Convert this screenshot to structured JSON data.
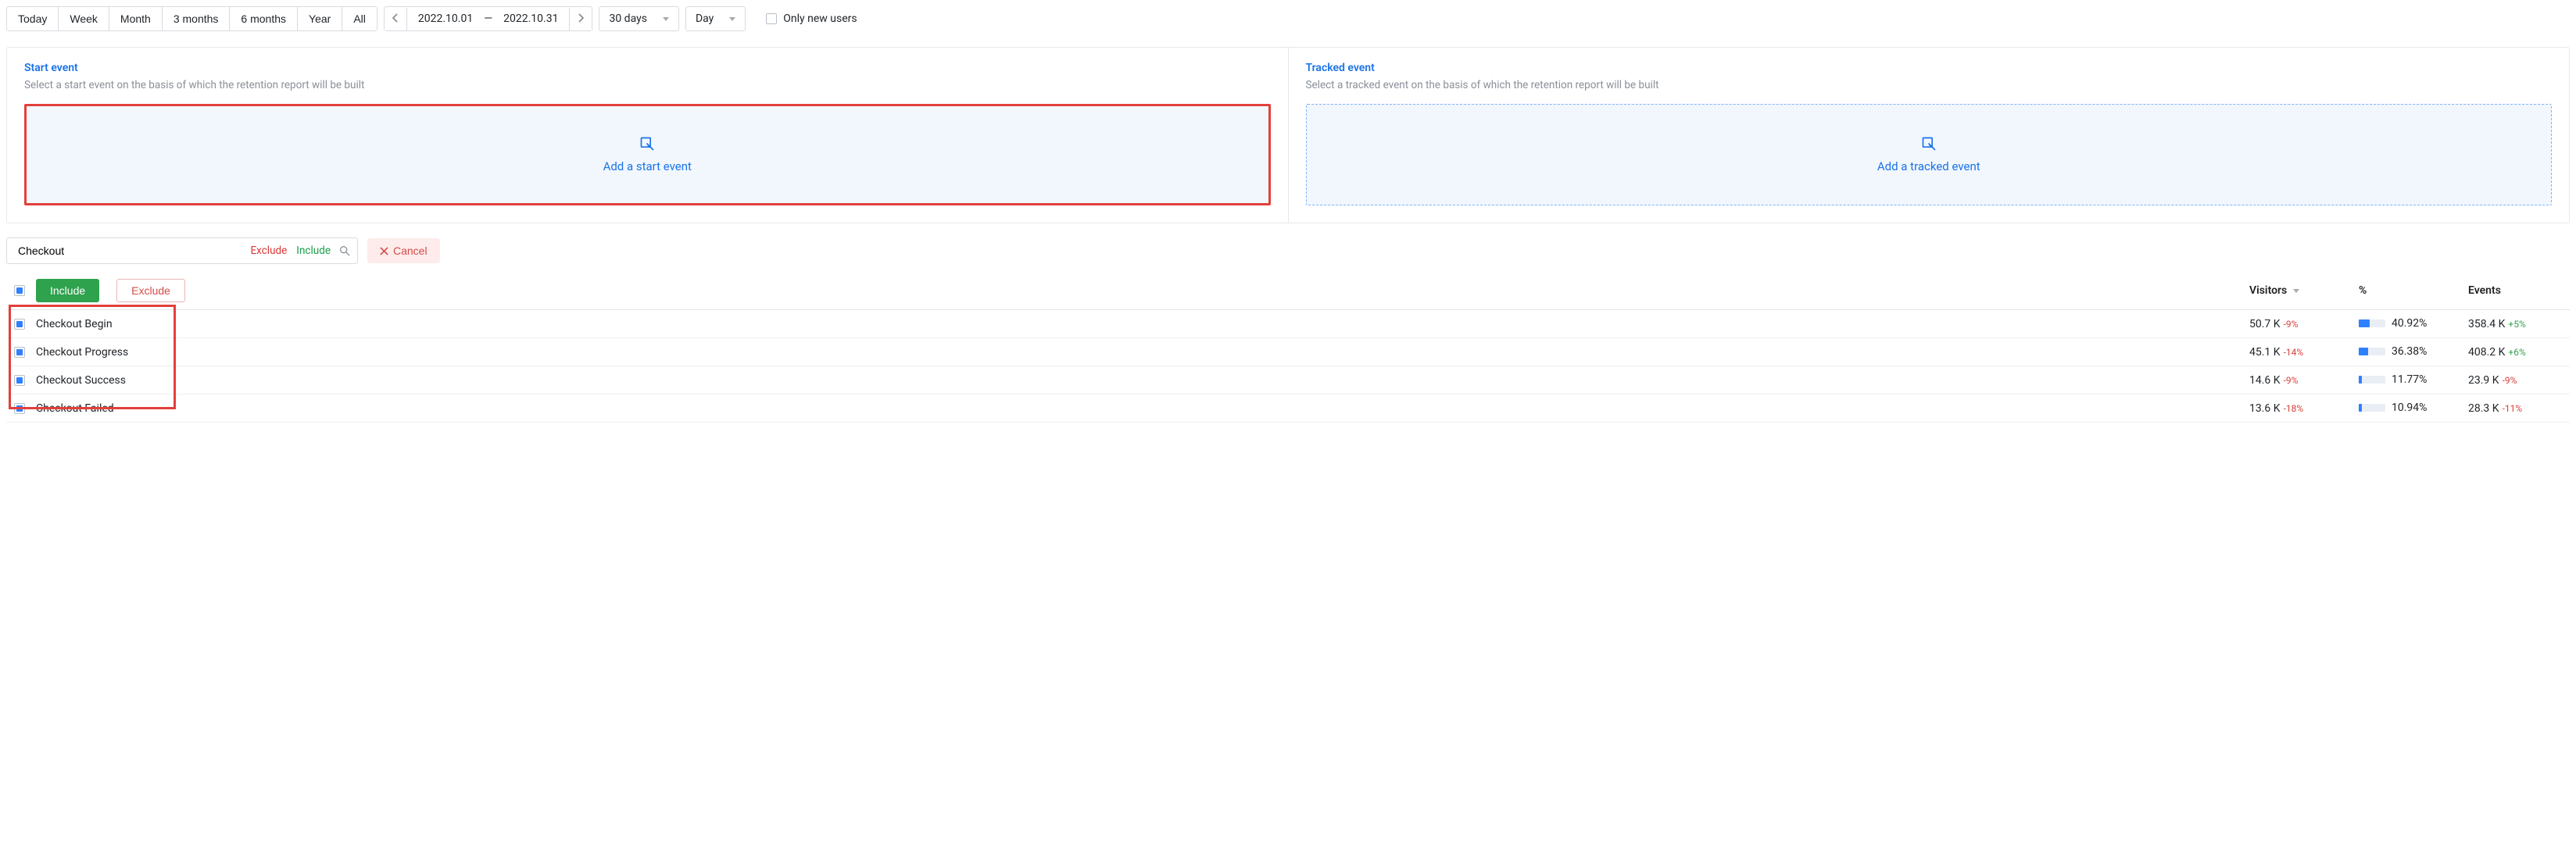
{
  "toolbar": {
    "ranges": [
      "Today",
      "Week",
      "Month",
      "3 months",
      "6 months",
      "Year",
      "All"
    ],
    "date_from": "2022.10.01",
    "date_sep": "—",
    "date_to": "2022.10.31",
    "window": "30 days",
    "granularity": "Day",
    "only_new_label": "Only new users"
  },
  "panels": {
    "start": {
      "title": "Start event",
      "subtitle": "Select a start event on the basis of which the retention report will be built",
      "cta": "Add a start event"
    },
    "tracked": {
      "title": "Tracked event",
      "subtitle": "Select a tracked event on the basis of which the retention report will be built",
      "cta": "Add a tracked event"
    }
  },
  "search": {
    "value": "Checkout",
    "exclude_label": "Exclude",
    "include_label": "Include",
    "cancel_label": "Cancel"
  },
  "table": {
    "include_btn": "Include",
    "exclude_btn": "Exclude",
    "headers": {
      "visitors": "Visitors",
      "pct": "%",
      "events": "Events"
    },
    "rows": [
      {
        "name": "Checkout Begin",
        "visitors": "50.7 K",
        "v_delta": "-9%",
        "pct": "40.92%",
        "pct_bar": 40.92,
        "events": "358.4 K",
        "e_delta": "+5%",
        "e_pos": true
      },
      {
        "name": "Checkout Progress",
        "visitors": "45.1 K",
        "v_delta": "-14%",
        "pct": "36.38%",
        "pct_bar": 36.38,
        "events": "408.2 K",
        "e_delta": "+6%",
        "e_pos": true
      },
      {
        "name": "Checkout Success",
        "visitors": "14.6 K",
        "v_delta": "-9%",
        "pct": "11.77%",
        "pct_bar": 11.77,
        "events": "23.9 K",
        "e_delta": "-9%",
        "e_pos": false
      },
      {
        "name": "Checkout Failed",
        "visitors": "13.6 K",
        "v_delta": "-18%",
        "pct": "10.94%",
        "pct_bar": 10.94,
        "events": "28.3 K",
        "e_delta": "-11%",
        "e_pos": false
      }
    ]
  }
}
